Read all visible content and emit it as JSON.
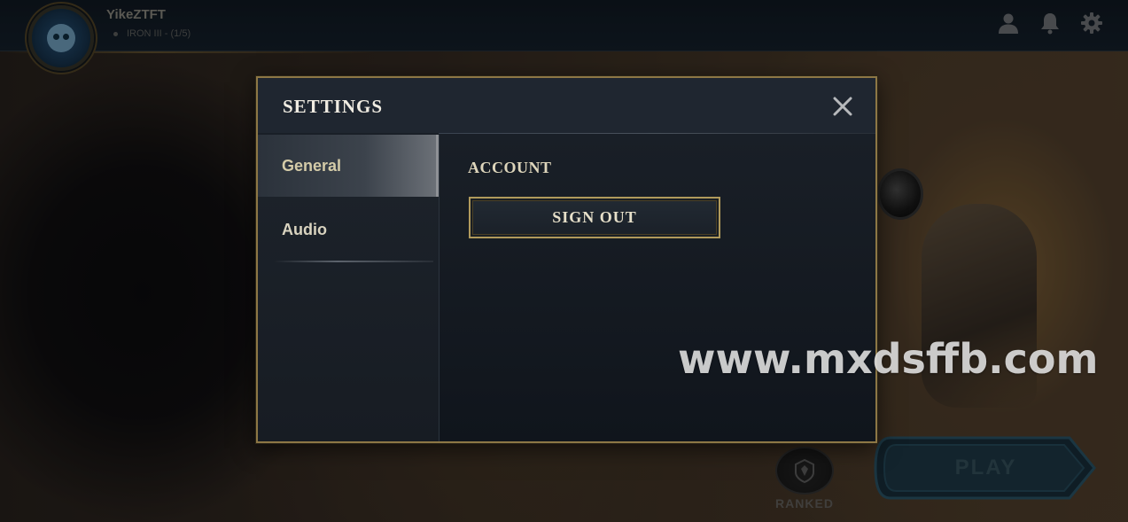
{
  "profile": {
    "username": "YikeZTFT",
    "rank": "IRON III - (1/5)"
  },
  "topbar": {
    "icons": [
      "profile-icon",
      "notification-bell-icon",
      "gear-icon"
    ]
  },
  "bottom": {
    "ranked_label": "RANKED",
    "play_label": "PLAY"
  },
  "settings": {
    "title": "SETTINGS",
    "tabs": [
      {
        "label": "General",
        "active": true
      },
      {
        "label": "Audio",
        "active": false
      }
    ],
    "general": {
      "section_title": "ACCOUNT",
      "sign_out_label": "SIGN OUT"
    }
  },
  "watermark": "www.mxdsffb.com",
  "colors": {
    "gold_border": "#8d7745",
    "modal_bg": "#141a21",
    "text_light": "#f0ece2",
    "play_teal": "#2f5e72"
  }
}
